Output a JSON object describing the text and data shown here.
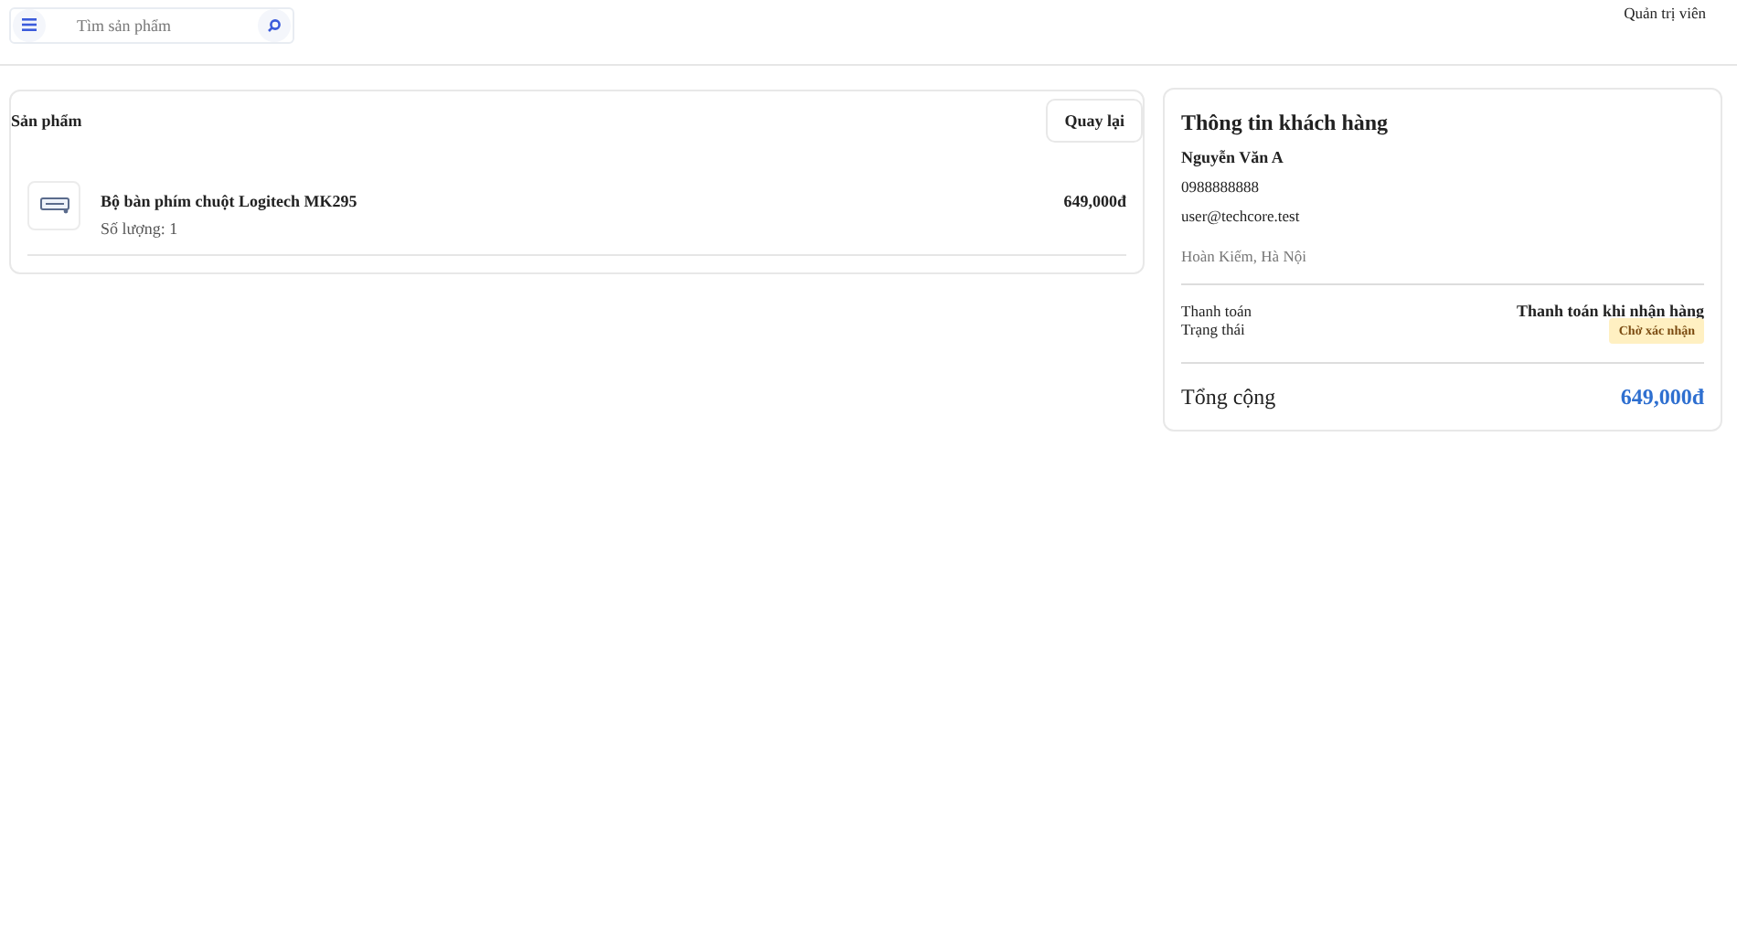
{
  "header": {
    "search": {
      "placeholder": "Tìm sản phẩm"
    },
    "user_role": "Quản trị viên"
  },
  "products_panel": {
    "title": "Sản phẩm",
    "back_button": "Quay lại",
    "items": [
      {
        "name": "Bộ bàn phím chuột Logitech MK295",
        "quantity": "Số lượng: 1",
        "price": "649,000đ"
      }
    ]
  },
  "customer_panel": {
    "title": "Thông tin khách hàng",
    "name": "Nguyễn Văn A",
    "phone": "0988888888",
    "email": "user@techcore.test",
    "address": "Hoàn Kiếm, Hà Nội",
    "payment_label": "Thanh toán",
    "payment_value": "Thanh toán khi nhận hàng",
    "status_label": "Trạng thái",
    "status_badge": "Chờ xác nhận",
    "total_label": "Tổng cộng",
    "total_value": "649,000đ"
  }
}
